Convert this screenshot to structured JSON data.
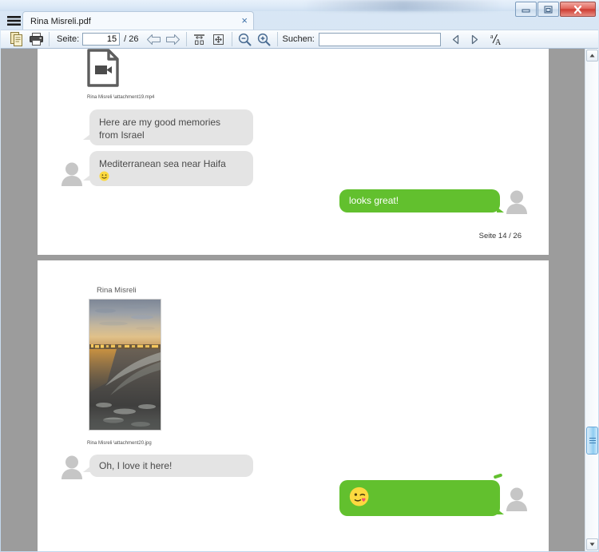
{
  "window": {
    "title_bar_blur": true,
    "minimize_label": "Minimieren",
    "maximize_label": "Maximieren",
    "close_label": "Schließen"
  },
  "tab": {
    "menu_icon": "hamburger-menu-icon",
    "label": "Rina Misreli.pdf",
    "close_glyph": "×"
  },
  "toolbar": {
    "copy_icon": "document-copy-icon",
    "print_icon": "printer-icon",
    "page_label": "Seite:",
    "page_value": "15",
    "page_total": "/ 26",
    "prev_page_icon": "arrow-left-icon",
    "next_page_icon": "arrow-right-icon",
    "fit_width_icon": "fit-width-icon",
    "fit_page_icon": "fit-page-icon",
    "zoom_out_icon": "magnifier-minus-icon",
    "zoom_in_icon": "magnifier-plus-icon",
    "search_label": "Suchen:",
    "search_value": "",
    "search_placeholder": "",
    "find_prev_icon": "triangle-left-icon",
    "find_next_icon": "triangle-right-icon",
    "text_select_icon": "text-select-icon"
  },
  "document": {
    "pages": [
      {
        "page_number": "14",
        "footer": "Seite 14 / 26",
        "attachment": {
          "icon": "video-file-icon",
          "caption": "Rina Misreli  \\attachment19.mp4"
        },
        "messages": [
          {
            "direction": "in",
            "text": "Here are my good memories\nfrom Israel",
            "emoji": ""
          },
          {
            "direction": "in",
            "text": "Mediterranean sea near Haifa",
            "emoji": "🙂",
            "emoji_name": "slightly-smiling-face-emoji",
            "has_avatar": true
          },
          {
            "direction": "out",
            "text": "looks great!",
            "emoji": "",
            "has_avatar": true
          }
        ]
      },
      {
        "page_number": "15",
        "footer": "",
        "sender_name": "Rina Misreli",
        "photo": {
          "name": "beach-sunset-photo",
          "description": "Mediterranean beach at sunset with city lights on the horizon"
        },
        "attachment": {
          "caption": "Rina Misreli  \\attachment20.jpg"
        },
        "messages": [
          {
            "direction": "in",
            "text": "Oh, I love it here!",
            "emoji": "",
            "has_avatar": true
          },
          {
            "direction": "out",
            "text": "",
            "emoji": "😘",
            "emoji_name": "face-blowing-a-kiss-emoji",
            "has_avatar": true
          }
        ]
      }
    ]
  },
  "scrollbar": {
    "up_icon": "scroll-up-icon",
    "down_icon": "scroll-down-icon",
    "thumb_name": "scroll-thumb"
  },
  "colors": {
    "bubble_out": "#62c02e",
    "bubble_in": "#e4e4e4",
    "page_background": "#9c9c9c",
    "avatar_gray": "#c6c6c6",
    "close_button": "#cd3b31"
  }
}
